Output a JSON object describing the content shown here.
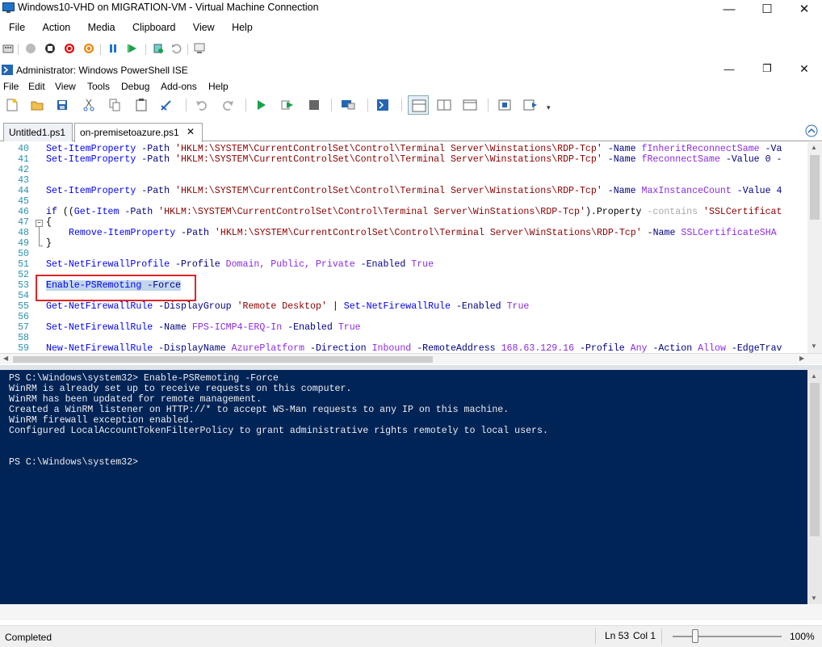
{
  "vm_window": {
    "title": "Windows10-VHD on MIGRATION-VM - Virtual Machine Connection",
    "minimize": "—",
    "maximize": "☐",
    "close": "✕",
    "menu": [
      "File",
      "Action",
      "Media",
      "Clipboard",
      "View",
      "Help"
    ],
    "toolbar_icons": [
      "ctrl-alt-del-icon",
      "start-icon",
      "turn-off-icon",
      "shutdown-icon",
      "save-state-icon",
      "pause-icon",
      "resume-icon",
      "checkpoint-icon",
      "revert-icon",
      "enhanced-session-icon"
    ]
  },
  "ise_window": {
    "title": "Administrator: Windows PowerShell ISE",
    "minimize": "—",
    "restore": "❐",
    "close": "✕",
    "menu": [
      "File",
      "Edit",
      "View",
      "Tools",
      "Debug",
      "Add-ons",
      "Help"
    ]
  },
  "tabs": [
    {
      "label": "Untitled1.ps1",
      "active": false
    },
    {
      "label": "on-premisetoazure.ps1",
      "active": true,
      "close": "✕"
    }
  ],
  "editor": {
    "line_numbers": [
      "40",
      "41",
      "42",
      "43",
      "44",
      "45",
      "46",
      "47",
      "48",
      "49",
      "50",
      "51",
      "52",
      "53",
      "54",
      "55",
      "56",
      "57",
      "58",
      "59"
    ],
    "lines": {
      "l40": {
        "cmd": "Set-ItemProperty",
        "p1": " -Path ",
        "s1": "'HKLM:\\SYSTEM\\CurrentControlSet\\Control\\Terminal Server\\Winstations\\RDP-Tcp'",
        "p2": " -Name ",
        "a1": "fInheritReconnectSame",
        "p3": " -Va"
      },
      "l41": {
        "cmd": "Set-ItemProperty",
        "p1": " -Path ",
        "s1": "'HKLM:\\SYSTEM\\CurrentControlSet\\Control\\Terminal Server\\Winstations\\RDP-Tcp'",
        "p2": " -Name ",
        "a1": "fReconnectSame",
        "p3": " -Value 0 -"
      },
      "l44": {
        "cmd": "Set-ItemProperty",
        "p1": " -Path ",
        "s1": "'HKLM:\\SYSTEM\\CurrentControlSet\\Control\\Terminal Server\\Winstations\\RDP-Tcp'",
        "p2": " -Name ",
        "a1": "MaxInstanceCount",
        "p3": " -Value 4"
      },
      "l46": {
        "kw": "if",
        "t1": " ((",
        "cmd": "Get-Item",
        "p1": " -Path ",
        "s1": "'HKLM:\\SYSTEM\\CurrentControlSet\\Control\\Terminal Server\\WinStations\\RDP-Tcp'",
        "t2": ").Property ",
        "op": "-contains",
        "s2": " 'SSLCertificat"
      },
      "l47": {
        "t1": "{"
      },
      "l48": {
        "cmd": "Remove-ItemProperty",
        "p1": " -Path ",
        "s1": "'HKLM:\\SYSTEM\\CurrentControlSet\\Control\\Terminal Server\\WinStations\\RDP-Tcp'",
        "p2": " -Name ",
        "a1": "SSLCertificateSHA"
      },
      "l49": {
        "t1": "}"
      },
      "l51": {
        "cmd": "Set-NetFirewallProfile",
        "p1": " -Profile ",
        "a1": "Domain, Public, Private",
        "p2": " -Enabled ",
        "a2": "True"
      },
      "l53": {
        "cmd": "Enable-PSRemoting",
        "p1": " -Force"
      },
      "l55": {
        "cmd": "Get-NetFirewallRule",
        "p1": " -DisplayGroup ",
        "s1": "'Remote Desktop'",
        "t1": " | ",
        "cmd2": "Set-NetFirewallRule",
        "p2": " -Enabled ",
        "a1": "True"
      },
      "l57": {
        "cmd": "Set-NetFirewallRule",
        "p1": " -Name ",
        "a1": "FPS-ICMP4-ERQ-In",
        "p2": " -Enabled ",
        "a2": "True"
      },
      "l59": {
        "cmd": "New-NetFirewallRule",
        "p1": " -DisplayName ",
        "a1": "AzurePlatform",
        "p2": " -Direction ",
        "a2": "Inbound",
        "p3": " -RemoteAddress ",
        "a3": "168.63.129.16",
        "p4": " -Profile ",
        "a4": "Any",
        "p5": " -Action ",
        "a5": "Allow",
        "p6": " -EdgeTrav"
      }
    }
  },
  "console": {
    "lines": [
      "PS C:\\Windows\\system32> Enable-PSRemoting -Force",
      "WinRM is already set up to receive requests on this computer.",
      "WinRM has been updated for remote management.",
      "Created a WinRM listener on HTTP://* to accept WS-Man requests to any IP on this machine.",
      "WinRM firewall exception enabled.",
      "Configured LocalAccountTokenFilterPolicy to grant administrative rights remotely to local users."
    ],
    "prompt": "PS C:\\Windows\\system32>"
  },
  "status": {
    "text": "Completed",
    "line": "Ln 53",
    "col": "Col 1",
    "zoom": "100%",
    "zoom_level": 100
  },
  "colors": {
    "console_bg": "#012456",
    "highlight_border": "#e02424",
    "selection": "#c2d6ec"
  }
}
